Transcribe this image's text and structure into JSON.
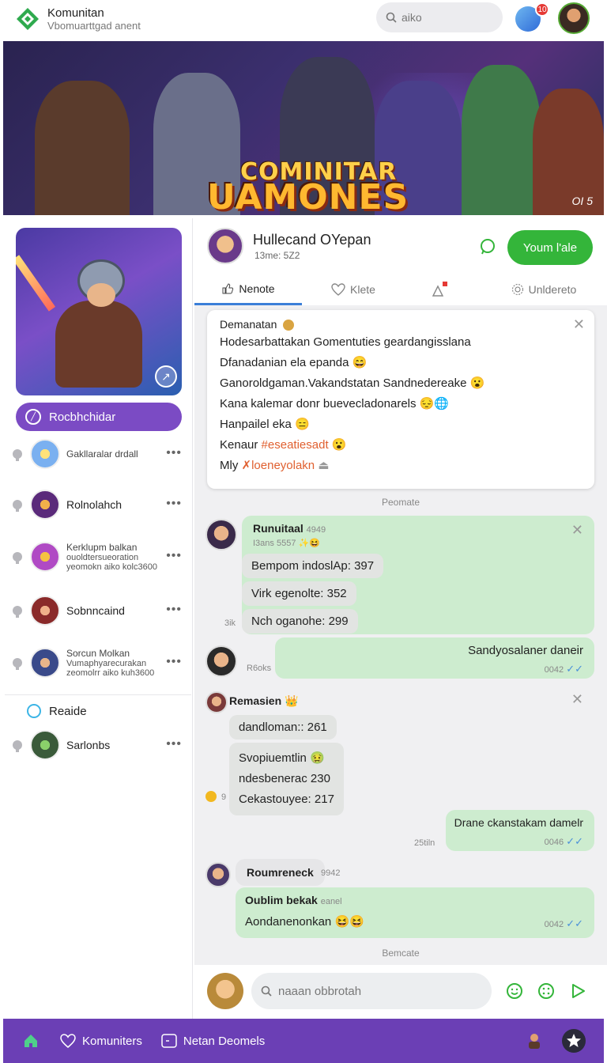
{
  "header": {
    "brand_title": "Komunitan",
    "brand_subtitle": "Vbomuarttgad anent",
    "search_text": "aiko",
    "notification_count": "10"
  },
  "banner": {
    "title_line1": "COMINITAR",
    "title_line2": "UAMONES",
    "corner_text": "OI 5"
  },
  "left": {
    "join_button": "Rocbhchidar",
    "friends": [
      {
        "name": "Gakllaralar drdall",
        "sub": ""
      },
      {
        "name": "Rolnolahch",
        "sub": ""
      },
      {
        "name": "Kerklupm balkan",
        "sub": "ouoldtersueoration yeomokn aiko kolc3600"
      },
      {
        "name": "Sobnncaind",
        "sub": ""
      },
      {
        "name": "Sorcun Molkan",
        "sub": "Vumaphyarecurakan zeomolrr aiko kuh3600"
      }
    ],
    "section_label": "Reaide",
    "section_friend": "Sarlonbs",
    "more_label": "•••"
  },
  "chat": {
    "title": "Hullecand OYepan",
    "subtitle": "13me: 5Z2",
    "cta": "Youm l'ale",
    "tabs": [
      "Nenote",
      "Klete",
      "",
      "Unldereto"
    ]
  },
  "pinned": {
    "header": "Demanatan",
    "lines": [
      "Hodesarbattakan Gomentuties geardangisslana",
      "Dfanadanian ela epanda",
      "Ganoroldgaman.Vakandstatan Sandnedereake",
      "Kana kalemar donr buevecladonarels",
      "Hanpailel eka",
      "Kenaur",
      "Mly"
    ],
    "hashtag": "#eseatiesadt",
    "link": "loeneyolakn",
    "close": "✕"
  },
  "separators": [
    "Peomate",
    "Bemcate"
  ],
  "messages": {
    "m1": {
      "author": "Runuitaal",
      "time": "4949",
      "meta": "I3ans 5557",
      "rows": [
        "Bempom indoslAp: 397",
        "Virk egenolte: 352",
        "Nch oganohe: 299"
      ],
      "side_label": "3ik",
      "close": "✕"
    },
    "m2": {
      "text": "Sandyosalaner daneir",
      "time": "0042",
      "side_label": "R6oks"
    },
    "m3": {
      "author": "Remasien",
      "rows": [
        "dandloman:: 261",
        "Svopiuemtlin",
        "ndesbenerac 230",
        "Cekastouyee: 217"
      ],
      "close": "✕",
      "side_label": "9"
    },
    "m4": {
      "text": "Drane ckanstakam damelr",
      "time": "0046",
      "side_label": "25tiln"
    },
    "m5": {
      "author": "Roumreneck",
      "time": "9942",
      "title": "Oublim bekak",
      "title_extra": "eanel",
      "text": "Aondanenonkan",
      "time2": "0042"
    }
  },
  "composer": {
    "placeholder": "naaan obbrotah"
  },
  "bottom_nav": {
    "items": [
      "Komuniters",
      "Netan Deomels"
    ]
  },
  "colors": {
    "accent": "#6b3fb5",
    "green": "#34b53a",
    "bubble": "#cdeccf"
  }
}
